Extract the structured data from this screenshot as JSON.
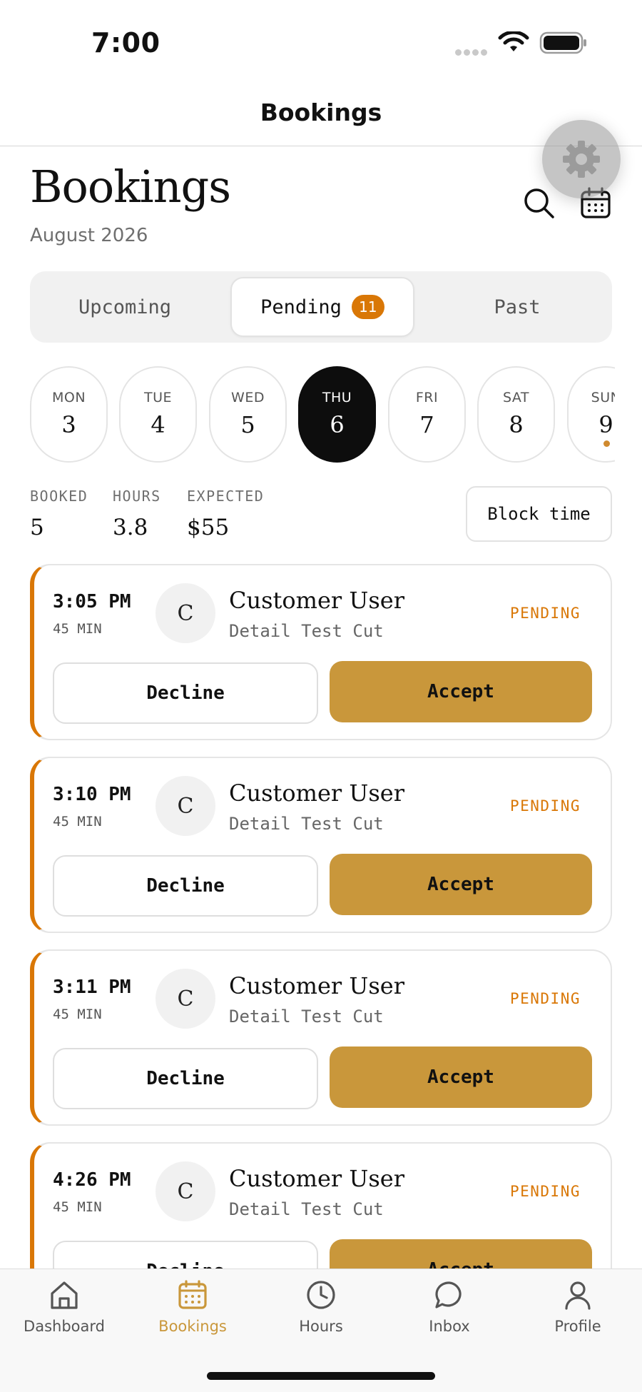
{
  "status": {
    "time": "7:00"
  },
  "nav": {
    "title": "Bookings"
  },
  "header": {
    "title": "Bookings",
    "subtitle": "August 2026",
    "icons": [
      "search-icon",
      "calendar-icon",
      "gear-icon"
    ]
  },
  "tabs": [
    {
      "label": "Upcoming",
      "active": false
    },
    {
      "label": "Pending",
      "active": true,
      "badge": "11"
    },
    {
      "label": "Past",
      "active": false
    }
  ],
  "days": [
    {
      "dow": "MON",
      "num": "3"
    },
    {
      "dow": "TUE",
      "num": "4"
    },
    {
      "dow": "WED",
      "num": "5"
    },
    {
      "dow": "THU",
      "num": "6",
      "selected": true
    },
    {
      "dow": "FRI",
      "num": "7"
    },
    {
      "dow": "SAT",
      "num": "8"
    },
    {
      "dow": "SUN",
      "num": "9",
      "has_dot": true
    }
  ],
  "stats": [
    {
      "label": "BOOKED",
      "value": "5"
    },
    {
      "label": "HOURS",
      "value": "3.8"
    },
    {
      "label": "EXPECTED",
      "value": "$55"
    }
  ],
  "block_time_label": "Block time",
  "bookings": [
    {
      "time": "3:05 PM",
      "duration": "45 MIN",
      "avatar": "C",
      "name": "Customer User",
      "service": "Detail Test Cut",
      "status": "PENDING",
      "decline": "Decline",
      "accept": "Accept"
    },
    {
      "time": "3:10 PM",
      "duration": "45 MIN",
      "avatar": "C",
      "name": "Customer User",
      "service": "Detail Test Cut",
      "status": "PENDING",
      "decline": "Decline",
      "accept": "Accept"
    },
    {
      "time": "3:11 PM",
      "duration": "45 MIN",
      "avatar": "C",
      "name": "Customer User",
      "service": "Detail Test Cut",
      "status": "PENDING",
      "decline": "Decline",
      "accept": "Accept"
    },
    {
      "time": "4:26 PM",
      "duration": "45 MIN",
      "avatar": "C",
      "name": "Customer User",
      "service": "Detail Test Cut",
      "status": "PENDING",
      "decline": "Decline",
      "accept": "Accept"
    }
  ],
  "tabbar": [
    {
      "label": "Dashboard",
      "icon": "home-icon",
      "active": false
    },
    {
      "label": "Bookings",
      "icon": "calendar-icon",
      "active": true
    },
    {
      "label": "Hours",
      "icon": "clock-icon",
      "active": false
    },
    {
      "label": "Inbox",
      "icon": "chat-bubble-icon",
      "active": false
    },
    {
      "label": "Profile",
      "icon": "person-icon",
      "active": false
    }
  ],
  "colors": {
    "accent": "#c9973b",
    "pending": "#d97706",
    "selected_day": "#0d0d0d"
  }
}
